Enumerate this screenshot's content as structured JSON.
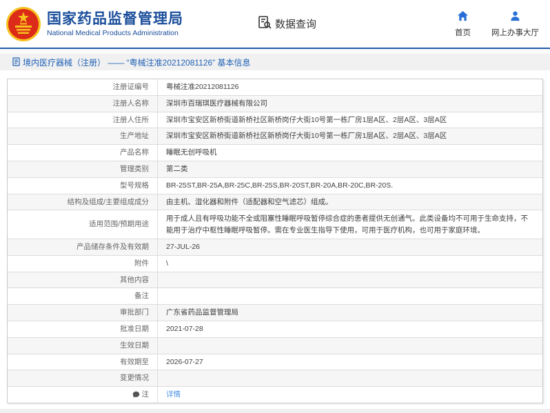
{
  "header": {
    "title": "国家药品监督管理局",
    "subtitle": "National Medical Products Administration",
    "section": "数据查询",
    "nav": [
      {
        "label": "首页",
        "icon": "home-icon"
      },
      {
        "label": "网上办事大厅",
        "icon": "user-icon"
      }
    ]
  },
  "breadcrumb": {
    "text": "境内医疗器械（注册） —— “粤械注准20212081126” 基本信息"
  },
  "colors": {
    "brand_blue": "#1b4e9b",
    "accent_blue": "#2a6fd6",
    "link_blue": "#4a90e2",
    "emblem_red": "#dc2b18",
    "emblem_gold": "#f7c21e"
  },
  "table": {
    "rows": [
      {
        "label": "注册证编号",
        "value": "粤械注准20212081126"
      },
      {
        "label": "注册人名称",
        "value": "深圳市百瑞琪医疗器械有限公司"
      },
      {
        "label": "注册人住所",
        "value": "深圳市宝安区新桥街道新桥社区新桥岗仔大街10号第一栋厂房1层A区、2层A区、3层A区"
      },
      {
        "label": "生产地址",
        "value": "深圳市宝安区新桥街道新桥社区新桥岗仔大街10号第一栋厂房1层A区、2层A区、3层A区"
      },
      {
        "label": "产品名称",
        "value": "睡眠无创呼吸机"
      },
      {
        "label": "管理类别",
        "value": "第二类"
      },
      {
        "label": "型号规格",
        "value": "BR-25ST,BR-25A,BR-25C,BR-25S,BR-20ST,BR-20A,BR-20C,BR-20S."
      },
      {
        "label": "结构及组成/主要组成成分",
        "value": "由主机、湿化器和附件（适配器和空气滤芯）组成。"
      },
      {
        "label": "适用范围/预期用途",
        "value": "用于成人且有呼吸功能不全或阻塞性睡眠呼吸暂停综合症的患者提供无创通气。此类设备均不可用于生命支持，不能用于治疗中枢性睡眠呼吸暂停。需在专业医生指导下使用，可用于医疗机构，也可用于家庭环境。",
        "multiline": true
      },
      {
        "label": "产品储存条件及有效期",
        "value": "27-JUL-26"
      },
      {
        "label": "附件",
        "value": "\\"
      },
      {
        "label": "其他内容",
        "value": ""
      },
      {
        "label": "备注",
        "value": ""
      },
      {
        "label": "审批部门",
        "value": "广东省药品监督管理局"
      },
      {
        "label": "批准日期",
        "value": "2021-07-28"
      },
      {
        "label": "生效日期",
        "value": ""
      },
      {
        "label": "有效期至",
        "value": "2026-07-27"
      },
      {
        "label": "变更情况",
        "value": ""
      },
      {
        "label": "注",
        "label_icon": "note-icon",
        "value": "详情",
        "link": true
      }
    ]
  }
}
